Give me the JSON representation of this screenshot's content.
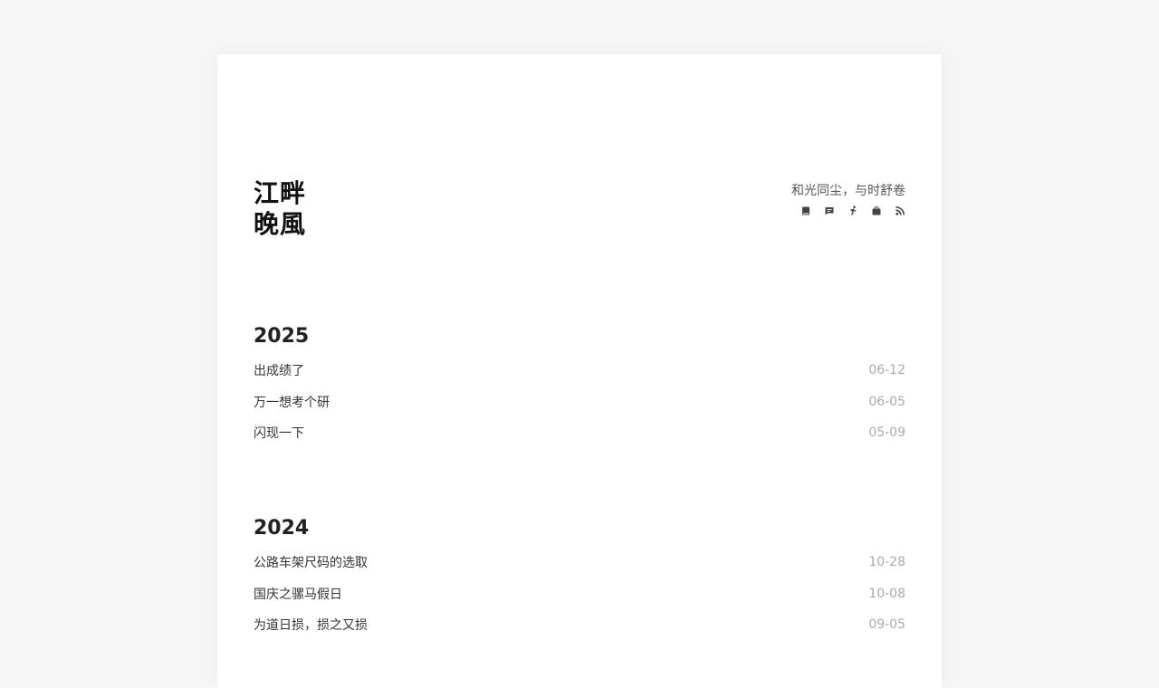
{
  "site": {
    "title_line1": "江畔",
    "title_line2": "晚風",
    "tagline": "和光同尘，与时舒卷"
  },
  "nav_icons": [
    {
      "name": "book-icon"
    },
    {
      "name": "comment-icon"
    },
    {
      "name": "runner-icon"
    },
    {
      "name": "briefcase-icon"
    },
    {
      "name": "rss-icon"
    }
  ],
  "archive": [
    {
      "year": "2025",
      "posts": [
        {
          "title": "出成绩了",
          "date": "06-12"
        },
        {
          "title": "万一想考个研",
          "date": "06-05"
        },
        {
          "title": "闪现一下",
          "date": "05-09"
        }
      ]
    },
    {
      "year": "2024",
      "posts": [
        {
          "title": "公路车架尺码的选取",
          "date": "10-28"
        },
        {
          "title": "国庆之骡马假日",
          "date": "10-08"
        },
        {
          "title": "为道日损，损之又损",
          "date": "09-05"
        }
      ]
    }
  ]
}
